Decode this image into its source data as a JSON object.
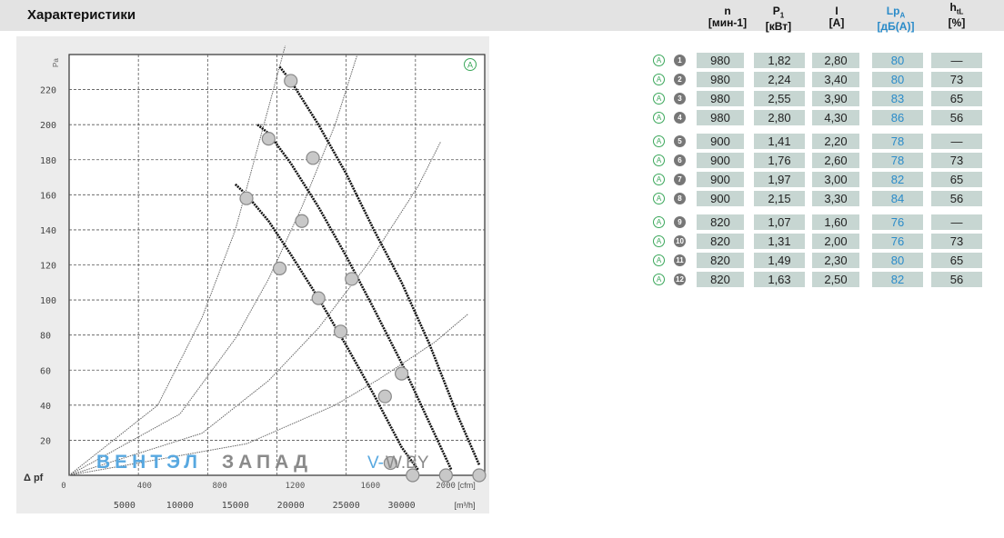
{
  "header": {
    "title": "Характеристики",
    "columns": [
      {
        "main": "n",
        "sub": "",
        "unit": "[мин-1]"
      },
      {
        "main": "P",
        "sub": "1",
        "unit": "[кВт]"
      },
      {
        "main": "I",
        "sub": "",
        "unit": "[A]"
      },
      {
        "main": "Lp",
        "sub": "A",
        "unit": "[дБ(A)]"
      },
      {
        "main": "h",
        "sub": "tL",
        "unit": "[%]"
      }
    ]
  },
  "colors": {
    "header_bg": "#e3e3e3",
    "cell_bg": "#c7d6d2",
    "accent_blue": "#2a8bc9",
    "marker_green": "#3aa75a",
    "watermark_blue": "#58a8e0",
    "watermark_gray": "#8a8a8a"
  },
  "table": {
    "rows": [
      {
        "mark": "A",
        "num": "1",
        "n": "980",
        "p1": "1,82",
        "i": "2,80",
        "lpa": "80",
        "htl": "—"
      },
      {
        "mark": "A",
        "num": "2",
        "n": "980",
        "p1": "2,24",
        "i": "3,40",
        "lpa": "80",
        "htl": "73"
      },
      {
        "mark": "A",
        "num": "3",
        "n": "980",
        "p1": "2,55",
        "i": "3,90",
        "lpa": "83",
        "htl": "65"
      },
      {
        "mark": "A",
        "num": "4",
        "n": "980",
        "p1": "2,80",
        "i": "4,30",
        "lpa": "86",
        "htl": "56"
      },
      {
        "mark": "A",
        "num": "5",
        "n": "900",
        "p1": "1,41",
        "i": "2,20",
        "lpa": "78",
        "htl": "—"
      },
      {
        "mark": "A",
        "num": "6",
        "n": "900",
        "p1": "1,76",
        "i": "2,60",
        "lpa": "78",
        "htl": "73"
      },
      {
        "mark": "A",
        "num": "7",
        "n": "900",
        "p1": "1,97",
        "i": "3,00",
        "lpa": "82",
        "htl": "65"
      },
      {
        "mark": "A",
        "num": "8",
        "n": "900",
        "p1": "2,15",
        "i": "3,30",
        "lpa": "84",
        "htl": "56"
      },
      {
        "mark": "A",
        "num": "9",
        "n": "820",
        "p1": "1,07",
        "i": "1,60",
        "lpa": "76",
        "htl": "—"
      },
      {
        "mark": "A",
        "num": "10",
        "n": "820",
        "p1": "1,31",
        "i": "2,00",
        "lpa": "76",
        "htl": "73"
      },
      {
        "mark": "A",
        "num": "11",
        "n": "820",
        "p1": "1,49",
        "i": "2,30",
        "lpa": "80",
        "htl": "65"
      },
      {
        "mark": "A",
        "num": "12",
        "n": "820",
        "p1": "1,63",
        "i": "2,50",
        "lpa": "82",
        "htl": "56"
      }
    ]
  },
  "chart_data": {
    "type": "line",
    "title": "",
    "corner_mark": "A",
    "xlabel": "[m³/h]",
    "xlabel_alt": "[cfm]",
    "ylabel": "Δ pf",
    "xlim": [
      0,
      37500
    ],
    "ylim": [
      0,
      240
    ],
    "x_ticks": [
      5000,
      10000,
      15000,
      20000,
      25000,
      30000
    ],
    "x_tick_labels": [
      "5000",
      "10000",
      "15000",
      "20000",
      "25000",
      "30000"
    ],
    "x_alt_ticks": [
      0,
      4000,
      8000,
      12000,
      16000,
      20000
    ],
    "x_alt_tick_labels": [
      "0",
      "400",
      "800",
      "1200",
      "1600",
      "2000"
    ],
    "y_ticks": [
      20,
      40,
      60,
      80,
      100,
      120,
      140,
      160,
      180,
      200,
      220
    ],
    "y_tick_labels": [
      "20",
      "40",
      "60",
      "80",
      "100",
      "120",
      "140",
      "160",
      "180",
      "200",
      "220"
    ],
    "y_top_label": "Pa",
    "grid": true,
    "fan_curves": [
      {
        "speed": "980",
        "points": [
          [
            19000,
            233
          ],
          [
            20000,
            225
          ],
          [
            22500,
            200
          ],
          [
            25000,
            172
          ],
          [
            27500,
            140
          ],
          [
            30000,
            110
          ],
          [
            32500,
            75
          ],
          [
            35000,
            35
          ],
          [
            37000,
            6
          ]
        ]
      },
      {
        "speed": "900",
        "points": [
          [
            17000,
            200
          ],
          [
            18000,
            195
          ],
          [
            20000,
            178
          ],
          [
            22500,
            153
          ],
          [
            25000,
            125
          ],
          [
            27500,
            95
          ],
          [
            30000,
            64
          ],
          [
            32500,
            30
          ],
          [
            34500,
            3
          ]
        ]
      },
      {
        "speed": "820",
        "points": [
          [
            15000,
            166
          ],
          [
            16000,
            160
          ],
          [
            18000,
            145
          ],
          [
            20000,
            126
          ],
          [
            22500,
            101
          ],
          [
            25000,
            74
          ],
          [
            27500,
            46
          ],
          [
            30000,
            16
          ],
          [
            31500,
            3
          ]
        ]
      }
    ],
    "system_curves": [
      {
        "points": [
          [
            0,
            0
          ],
          [
            8000,
            40
          ],
          [
            12000,
            90
          ],
          [
            15000,
            140
          ],
          [
            18000,
            210
          ],
          [
            19500,
            245
          ]
        ]
      },
      {
        "points": [
          [
            0,
            0
          ],
          [
            10000,
            35
          ],
          [
            15000,
            78
          ],
          [
            18000,
            112
          ],
          [
            21000,
            153
          ],
          [
            24000,
            200
          ],
          [
            26000,
            240
          ]
        ]
      },
      {
        "points": [
          [
            0,
            0
          ],
          [
            12000,
            24
          ],
          [
            18000,
            54
          ],
          [
            22500,
            84
          ],
          [
            27000,
            121
          ],
          [
            31500,
            165
          ],
          [
            33500,
            190
          ]
        ]
      },
      {
        "points": [
          [
            0,
            0
          ],
          [
            16000,
            18
          ],
          [
            24000,
            40
          ],
          [
            28000,
            55
          ],
          [
            33000,
            76
          ],
          [
            36000,
            92
          ]
        ]
      }
    ],
    "operating_points": [
      {
        "x": 20000,
        "y": 225
      },
      {
        "x": 22000,
        "y": 181
      },
      {
        "x": 25500,
        "y": 112
      },
      {
        "x": 30000,
        "y": 58
      },
      {
        "x": 18000,
        "y": 192
      },
      {
        "x": 21000,
        "y": 145
      },
      {
        "x": 24500,
        "y": 82
      },
      {
        "x": 28500,
        "y": 45
      },
      {
        "x": 16000,
        "y": 158
      },
      {
        "x": 19000,
        "y": 118
      },
      {
        "x": 22500,
        "y": 101
      },
      {
        "x": 29000,
        "y": 7
      }
    ],
    "end_points": [
      {
        "x": 31000,
        "y": 0
      },
      {
        "x": 34000,
        "y": 0
      },
      {
        "x": 37000,
        "y": 0
      }
    ]
  },
  "watermark": {
    "part1": "ВЕНТЭЛ",
    "part2": "ЗАПАД",
    "part3": "V-",
    "part4": "W.BY"
  }
}
